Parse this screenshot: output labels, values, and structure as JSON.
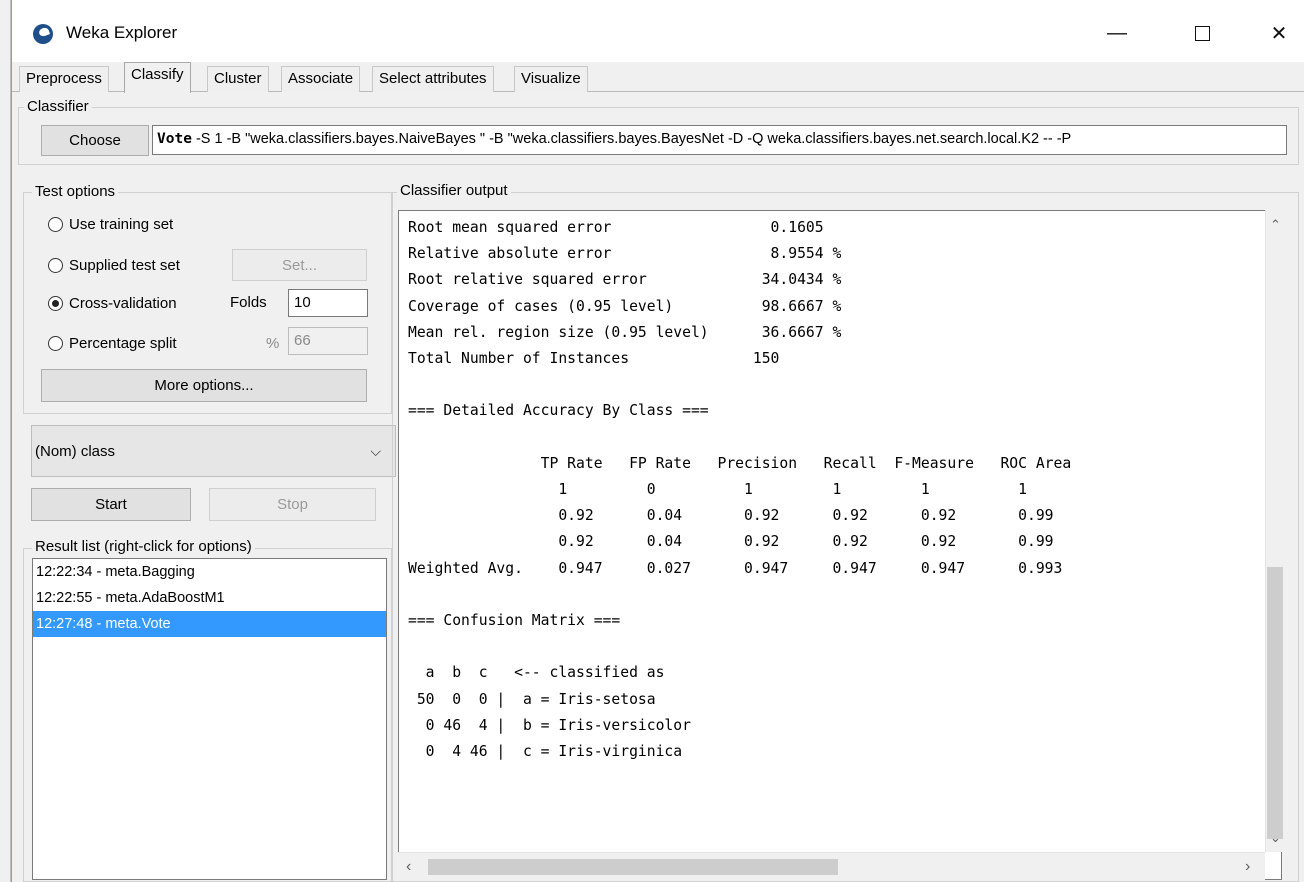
{
  "window": {
    "title": "Weka Explorer",
    "minimize_glyph": "—",
    "close_glyph": "✕"
  },
  "tabs": [
    {
      "label": "Preprocess"
    },
    {
      "label": "Classify",
      "active": true
    },
    {
      "label": "Cluster"
    },
    {
      "label": "Associate"
    },
    {
      "label": "Select attributes"
    },
    {
      "label": "Visualize"
    }
  ],
  "classifier": {
    "group_label": "Classifier",
    "choose_label": "Choose",
    "name": "Vote",
    "options": " -S 1 -B \"weka.classifiers.bayes.NaiveBayes \" -B \"weka.classifiers.bayes.BayesNet -D -Q weka.classifiers.bayes.net.search.local.K2 -- -P"
  },
  "test_options": {
    "group_label": "Test options",
    "use_training_set": "Use training set",
    "supplied_test_set": "Supplied test set",
    "set_button": "Set...",
    "cross_validation": "Cross-validation",
    "folds_label": "Folds",
    "folds_value": "10",
    "percentage_split": "Percentage split",
    "percent_label": "%",
    "percent_value": "66",
    "more_options": "More options...",
    "selected": "cross_validation"
  },
  "class_select": {
    "value": "(Nom) class"
  },
  "actions": {
    "start": "Start",
    "stop": "Stop"
  },
  "result_list": {
    "label": "Result list (right-click for options)",
    "items": [
      {
        "text": "12:22:34 - meta.Bagging"
      },
      {
        "text": "12:22:55 - meta.AdaBoostM1"
      },
      {
        "text": "12:27:48 - meta.Vote",
        "selected": true
      }
    ]
  },
  "output": {
    "label": "Classifier output",
    "lines": [
      "Root mean squared error                  0.1605",
      "Relative absolute error                  8.9554 %",
      "Root relative squared error             34.0434 %",
      "Coverage of cases (0.95 level)          98.6667 %",
      "Mean rel. region size (0.95 level)      36.6667 %",
      "Total Number of Instances              150",
      "",
      "=== Detailed Accuracy By Class ===",
      "",
      "               TP Rate   FP Rate   Precision   Recall  F-Measure   ROC Area",
      "                 1         0          1         1         1          1",
      "                 0.92      0.04       0.92      0.92      0.92       0.99",
      "                 0.92      0.04       0.92      0.92      0.92       0.99",
      "Weighted Avg.    0.947     0.027      0.947     0.947     0.947      0.993",
      "",
      "=== Confusion Matrix ===",
      "",
      "  a  b  c   <-- classified as",
      " 50  0  0 |  a = Iris-setosa",
      "  0 46  4 |  b = Iris-versicolor",
      "  0  4 46 |  c = Iris-virginica"
    ]
  }
}
